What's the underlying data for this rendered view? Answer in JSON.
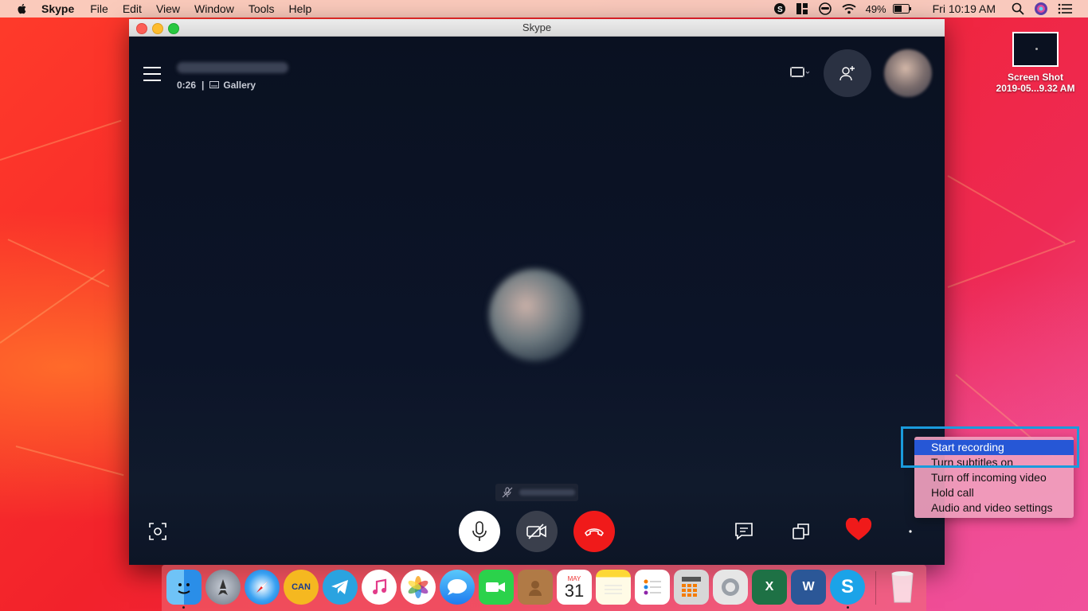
{
  "menubar": {
    "app_name": "Skype",
    "menus": [
      "File",
      "Edit",
      "View",
      "Window",
      "Tools",
      "Help"
    ],
    "battery": "49%",
    "clock": "Fri 10:19 AM"
  },
  "desktop_file": {
    "name_line1": "Screen Shot",
    "name_line2": "2019-05...9.32 AM"
  },
  "window": {
    "title": "Skype"
  },
  "call": {
    "duration": "0:26",
    "separator": "|",
    "view_label": "Gallery"
  },
  "context_menu": {
    "items": [
      "Start recording",
      "Turn subtitles on",
      "Turn off incoming video",
      "Hold call",
      "Audio and video settings"
    ],
    "active_index": 0
  },
  "dock": {
    "icons": [
      "finder-icon",
      "launchpad-icon",
      "safari-icon",
      "can-app-icon",
      "telegram-icon",
      "itunes-icon",
      "photos-icon",
      "messages-icon",
      "facetime-icon",
      "contacts-icon",
      "calendar-icon",
      "notes-icon",
      "reminders-icon",
      "calculator-icon",
      "tor-icon",
      "excel-icon",
      "word-icon",
      "skype-icon",
      "trash-icon"
    ],
    "calendar_month": "MAY",
    "calendar_day": "31"
  },
  "colors": {
    "accent_blue": "#2657d6",
    "end_call_red": "#f01a1a",
    "highlight_border": "#1a9bdc"
  }
}
